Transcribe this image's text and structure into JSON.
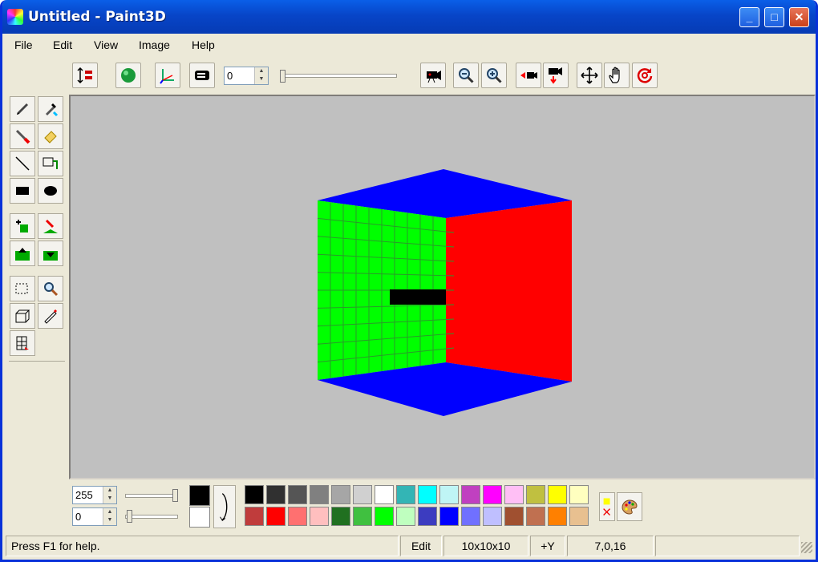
{
  "window": {
    "title": "Untitled - Paint3D",
    "minimize_label": "_",
    "maximize_label": "□",
    "close_label": "✕"
  },
  "menu": [
    "File",
    "Edit",
    "View",
    "Image",
    "Help"
  ],
  "toolbar": {
    "rotation_value": "0",
    "buttons": [
      "mode-toggle",
      "render-sphere",
      "axes",
      "display-mode",
      "camera",
      "zoom-out",
      "zoom-in",
      "move-camera-left",
      "camera-down",
      "move",
      "pan",
      "rotate"
    ]
  },
  "tools": [
    "pencil",
    "eyedropper",
    "brush",
    "eraser",
    "line",
    "copy-block",
    "rectangle",
    "ellipse",
    "add-voxel",
    "extrude",
    "raise",
    "lower",
    "select",
    "magnify",
    "box",
    "pen",
    "grid"
  ],
  "color_controls": {
    "value_top": "255",
    "value_bottom": "0",
    "foreground": "#000000",
    "background": "#ffffff"
  },
  "palette": {
    "row1": [
      "#000000",
      "#303030",
      "#555555",
      "#808080",
      "#a6a6a6",
      "#d0d0d0",
      "#ffffff",
      "#33b5b5",
      "#00ffff",
      "#bff5f5",
      "#c040c0",
      "#ff00ff",
      "#ffbff5",
      "#c0c040",
      "#ffff00",
      "#ffffbf"
    ],
    "row2": [
      "#c03c3c",
      "#ff0000",
      "#ff7070",
      "#ffbfbf",
      "#207020",
      "#40c040",
      "#00ff00",
      "#bfffbf",
      "#3c3cc0",
      "#0000ff",
      "#7070ff",
      "#bfbfff",
      "#a05030",
      "#c07050",
      "#ff8000",
      "#e8c090"
    ]
  },
  "status": {
    "help": "Press F1 for help.",
    "mode": "Edit",
    "size": "10x10x10",
    "axis": "+Y",
    "coords": "7,0,16"
  },
  "scene": {
    "colors": {
      "top": "#0000ff",
      "left": "#00ff00",
      "right": "#ff0000",
      "bottom": "#0000ff",
      "block": "#000000"
    }
  }
}
